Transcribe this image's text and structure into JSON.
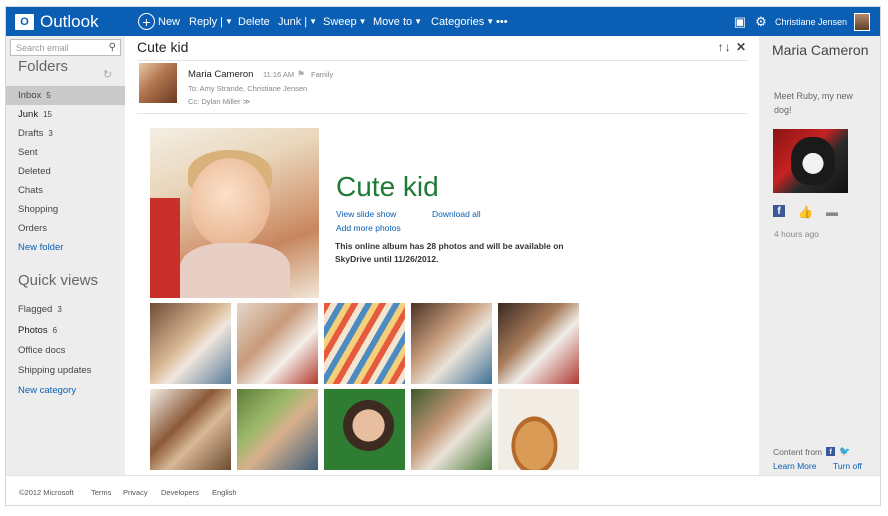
{
  "brand": {
    "logo": "O",
    "name": "Outlook"
  },
  "toolbar": {
    "new": "New",
    "reply": "Reply |",
    "delete": "Delete",
    "junk": "Junk |",
    "sweep": "Sweep",
    "move_to": "Move to",
    "categories": "Categories",
    "more": "•••"
  },
  "user": {
    "name": "Christiane Jensen"
  },
  "search": {
    "placeholder": "Search email"
  },
  "folders": {
    "heading": "Folders",
    "items": [
      {
        "label": "Inbox",
        "count": "5"
      },
      {
        "label": "Junk",
        "count": "15"
      },
      {
        "label": "Drafts",
        "count": "3"
      },
      {
        "label": "Sent",
        "count": ""
      },
      {
        "label": "Deleted",
        "count": ""
      },
      {
        "label": "Chats",
        "count": ""
      },
      {
        "label": "Shopping",
        "count": ""
      },
      {
        "label": "Orders",
        "count": ""
      }
    ],
    "new_folder": "New folder"
  },
  "quick_views": {
    "heading": "Quick views",
    "items": [
      {
        "label": "Flagged",
        "count": "3"
      },
      {
        "label": "Photos",
        "count": "6"
      },
      {
        "label": "Office docs",
        "count": ""
      },
      {
        "label": "Shipping updates",
        "count": ""
      }
    ],
    "new_category": "New category"
  },
  "message": {
    "subject": "Cute kid",
    "actions": "↑↓ ✕",
    "sender": "Maria Cameron",
    "time": "11:16 AM",
    "category": "Family",
    "to": "To: Amy Strande, Christiane Jensen",
    "cc": "Cc: Dylan Miller ≫"
  },
  "album": {
    "title": "Cute kid",
    "view_slide_show": "View slide show",
    "download_all": "Download all",
    "add_more_photos": "Add more photos",
    "note": "This online album has 28 photos and will be available on SkyDrive until 11/26/2012."
  },
  "social": {
    "name": "Maria Cameron",
    "status": "Meet Ruby, my new dog!",
    "time": "4 hours ago",
    "content_from": "Content from",
    "learn_more": "Learn More",
    "turn_off": "Turn off"
  },
  "footer": {
    "copyright": "©2012 Microsoft",
    "terms": "Terms",
    "privacy": "Privacy",
    "developers": "Developers",
    "language": "English"
  }
}
